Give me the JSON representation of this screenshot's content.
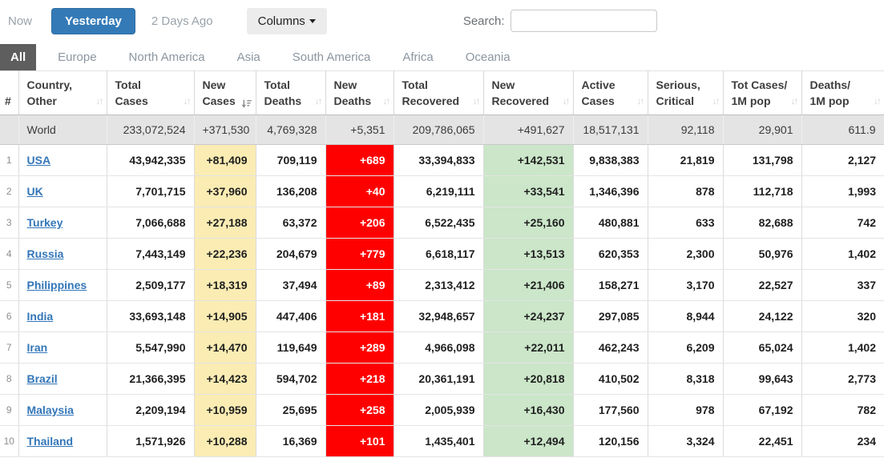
{
  "toolbar": {
    "now_label": "Now",
    "yesterday_label": "Yesterday",
    "two_days_ago_label": "2 Days Ago",
    "columns_label": "Columns",
    "search_label": "Search:",
    "search_value": ""
  },
  "tabs": [
    {
      "label": "All",
      "active": true
    },
    {
      "label": "Europe",
      "active": false
    },
    {
      "label": "North America",
      "active": false
    },
    {
      "label": "Asia",
      "active": false
    },
    {
      "label": "South America",
      "active": false
    },
    {
      "label": "Africa",
      "active": false
    },
    {
      "label": "Oceania",
      "active": false
    }
  ],
  "table": {
    "headers": [
      {
        "key": "rank",
        "lines": [
          "#"
        ],
        "sort": null
      },
      {
        "key": "country",
        "lines": [
          "Country,",
          "Other"
        ],
        "sort": "unsorted"
      },
      {
        "key": "total_cases",
        "lines": [
          "Total",
          "Cases"
        ],
        "sort": "unsorted"
      },
      {
        "key": "new_cases",
        "lines": [
          "New",
          "Cases"
        ],
        "sort": "desc"
      },
      {
        "key": "total_deaths",
        "lines": [
          "Total",
          "Deaths"
        ],
        "sort": "unsorted"
      },
      {
        "key": "new_deaths",
        "lines": [
          "New",
          "Deaths"
        ],
        "sort": "unsorted"
      },
      {
        "key": "total_recovered",
        "lines": [
          "Total",
          "Recovered"
        ],
        "sort": "unsorted"
      },
      {
        "key": "new_recovered",
        "lines": [
          "New",
          "Recovered"
        ],
        "sort": "unsorted"
      },
      {
        "key": "active_cases",
        "lines": [
          "Active",
          "Cases"
        ],
        "sort": "unsorted"
      },
      {
        "key": "serious_critical",
        "lines": [
          "Serious,",
          "Critical"
        ],
        "sort": "unsorted"
      },
      {
        "key": "tot_cases_1m",
        "lines": [
          "Tot Cases/",
          "1M pop"
        ],
        "sort": "unsorted"
      },
      {
        "key": "deaths_1m",
        "lines": [
          "Deaths/",
          "1M pop"
        ],
        "sort": "unsorted"
      }
    ],
    "world_row": {
      "rank": "",
      "country": "World",
      "total_cases": "233,072,524",
      "new_cases": "+371,530",
      "total_deaths": "4,769,328",
      "new_deaths": "+5,351",
      "total_recovered": "209,786,065",
      "new_recovered": "+491,627",
      "active_cases": "18,517,131",
      "serious_critical": "92,118",
      "tot_cases_1m": "29,901",
      "deaths_1m": "611.9"
    },
    "rows": [
      {
        "rank": "1",
        "country": "USA",
        "total_cases": "43,942,335",
        "new_cases": "+81,409",
        "total_deaths": "709,119",
        "new_deaths": "+689",
        "total_recovered": "33,394,833",
        "new_recovered": "+142,531",
        "active_cases": "9,838,383",
        "serious_critical": "21,819",
        "tot_cases_1m": "131,798",
        "deaths_1m": "2,127"
      },
      {
        "rank": "2",
        "country": "UK",
        "total_cases": "7,701,715",
        "new_cases": "+37,960",
        "total_deaths": "136,208",
        "new_deaths": "+40",
        "total_recovered": "6,219,111",
        "new_recovered": "+33,541",
        "active_cases": "1,346,396",
        "serious_critical": "878",
        "tot_cases_1m": "112,718",
        "deaths_1m": "1,993"
      },
      {
        "rank": "3",
        "country": "Turkey",
        "total_cases": "7,066,688",
        "new_cases": "+27,188",
        "total_deaths": "63,372",
        "new_deaths": "+206",
        "total_recovered": "6,522,435",
        "new_recovered": "+25,160",
        "active_cases": "480,881",
        "serious_critical": "633",
        "tot_cases_1m": "82,688",
        "deaths_1m": "742"
      },
      {
        "rank": "4",
        "country": "Russia",
        "total_cases": "7,443,149",
        "new_cases": "+22,236",
        "total_deaths": "204,679",
        "new_deaths": "+779",
        "total_recovered": "6,618,117",
        "new_recovered": "+13,513",
        "active_cases": "620,353",
        "serious_critical": "2,300",
        "tot_cases_1m": "50,976",
        "deaths_1m": "1,402"
      },
      {
        "rank": "5",
        "country": "Philippines",
        "total_cases": "2,509,177",
        "new_cases": "+18,319",
        "total_deaths": "37,494",
        "new_deaths": "+89",
        "total_recovered": "2,313,412",
        "new_recovered": "+21,406",
        "active_cases": "158,271",
        "serious_critical": "3,170",
        "tot_cases_1m": "22,527",
        "deaths_1m": "337"
      },
      {
        "rank": "6",
        "country": "India",
        "total_cases": "33,693,148",
        "new_cases": "+14,905",
        "total_deaths": "447,406",
        "new_deaths": "+181",
        "total_recovered": "32,948,657",
        "new_recovered": "+24,237",
        "active_cases": "297,085",
        "serious_critical": "8,944",
        "tot_cases_1m": "24,122",
        "deaths_1m": "320"
      },
      {
        "rank": "7",
        "country": "Iran",
        "total_cases": "5,547,990",
        "new_cases": "+14,470",
        "total_deaths": "119,649",
        "new_deaths": "+289",
        "total_recovered": "4,966,098",
        "new_recovered": "+22,011",
        "active_cases": "462,243",
        "serious_critical": "6,209",
        "tot_cases_1m": "65,024",
        "deaths_1m": "1,402"
      },
      {
        "rank": "8",
        "country": "Brazil",
        "total_cases": "21,366,395",
        "new_cases": "+14,423",
        "total_deaths": "594,702",
        "new_deaths": "+218",
        "total_recovered": "20,361,191",
        "new_recovered": "+20,818",
        "active_cases": "410,502",
        "serious_critical": "8,318",
        "tot_cases_1m": "99,643",
        "deaths_1m": "2,773"
      },
      {
        "rank": "9",
        "country": "Malaysia",
        "total_cases": "2,209,194",
        "new_cases": "+10,959",
        "total_deaths": "25,695",
        "new_deaths": "+258",
        "total_recovered": "2,005,939",
        "new_recovered": "+16,430",
        "active_cases": "177,560",
        "serious_critical": "978",
        "tot_cases_1m": "67,192",
        "deaths_1m": "782"
      },
      {
        "rank": "10",
        "country": "Thailand",
        "total_cases": "1,571,926",
        "new_cases": "+10,288",
        "total_deaths": "16,369",
        "new_deaths": "+101",
        "total_recovered": "1,435,401",
        "new_recovered": "+12,494",
        "active_cases": "120,156",
        "serious_critical": "3,324",
        "tot_cases_1m": "22,451",
        "deaths_1m": "234"
      }
    ]
  },
  "icons": {
    "unsorted_sort_icon": "↓↑",
    "columns_caret_icon": "caret-down"
  },
  "colors": {
    "accent_blue": "#337AB7",
    "link_blue": "#3376B8",
    "highlight_yellow": "#FAECB3",
    "highlight_red": "#FF0000",
    "highlight_green": "#CBE6C9",
    "world_row_gray": "#E4E4E4",
    "tab_active_gray": "#5E5E5E"
  }
}
